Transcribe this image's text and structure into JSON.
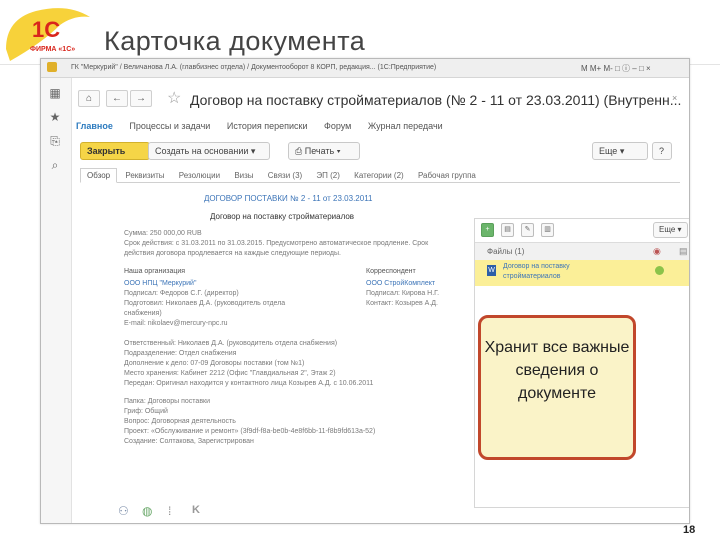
{
  "slide": {
    "title": "Карточка документа",
    "logo_text": "1С",
    "logo_subtext": "ФИРМА «1С»",
    "page_number": "18"
  },
  "window": {
    "titlebar_text": "ГК \"Меркурий\" / Величанова Л.А. (главбизнес отдела) / Документооборот 8 КОРП, редакция... (1С:Предприятие)",
    "title_controls": "M  M+  M-  □  ⓘ  –  □  ×"
  },
  "leftbar_icons": [
    "grid-icon",
    "favorites-star-icon",
    "history-icon",
    "search-icon"
  ],
  "document": {
    "title": "Договор на поставку стройматериалов (№ 2 - 11 от 23.03.2011) (Внутренн...",
    "close_symbol": "×",
    "nav_links": [
      "Главное",
      "Процессы и задачи",
      "История переписки",
      "Форум",
      "Журнал передачи"
    ],
    "active_link_index": 0,
    "toolbar": {
      "close_label": "Закрыть",
      "create_label": "Создать на основании",
      "print_label": "Печать",
      "more_label": "Еще",
      "help_label": "?"
    },
    "tabs": [
      "Обзор",
      "Реквизиты",
      "Резолюции",
      "Визы",
      "Связи (3)",
      "ЭП (2)",
      "Категории (2)",
      "Рабочая группа"
    ],
    "active_tab_index": 0,
    "heading": "ДОГОВОР ПОСТАВКИ № 2 - 11 от 23.03.2011",
    "subheading": "Договор на поставку стройматериалов",
    "lines": [
      "Сумма: 250 000,00 RUB",
      "Срок действия: с 31.03.2011 по 31.03.2015. Предусмотрено автоматическое продление. Срок",
      "действия договора продлевается на каждые следующие периоды.",
      "Наша организация",
      "ООО НПЦ \"Меркурий\"",
      "Подписал: Федоров С.Г. (директор)",
      "Подготовил: Николаев Д.А. (руководитель отдела",
      "снабжения)",
      "E-mail: nikolaev@mercury-npc.ru",
      "Корреспондент",
      "ООО СтройКомплект",
      "Подписал: Кирова Н.Г.",
      "Контакт: Козырев А.Д.",
      "Ответственный: Николаев Д.А. (руководитель отдела снабжения)",
      "Подразделение: Отдел снабжения",
      "Дополнение к дело: 07-09 Договоры поставки (том №1)",
      "Место хранения: Кабинет 2212 (Офис \"Главдиальная 2\", Этаж 2)",
      "Передан: Оригинал находится у контактного лица Козырев А.Д. с 10.06.2011",
      "Папка: Договоры поставки",
      "Гриф: Общий",
      "Вопрос: Договорная деятельность",
      "Проект: «Обслуживание и ремонт» (3f9df-f8a-be0b-4e8f6bb-11-f8b9fd613a-52)",
      "Создание: Солтакова, Зарегистрирован"
    ]
  },
  "files_panel": {
    "more_label": "Еще",
    "header_label": "Файлы (1)",
    "file_name_line1": "Договор на поставку",
    "file_name_line2": "стройматериалов"
  },
  "callout": {
    "text": "Хранит все важные сведения о документе"
  },
  "bottom_icons": [
    "users-icon",
    "globe-icon",
    "attributes-icon",
    "k-icon"
  ],
  "colors": {
    "accent_blue": "#3d75b8",
    "primary_button": "#f5d547",
    "selected_row": "#fbef98",
    "callout_border": "#c1472b",
    "callout_fill": "#faf3c8",
    "logo_yellow": "#f7d23a",
    "logo_red": "#d9261c"
  }
}
